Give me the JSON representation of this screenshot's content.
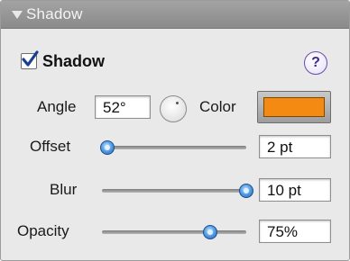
{
  "panel": {
    "title": "Shadow",
    "enable_checkbox": {
      "label": "Shadow",
      "checked": true
    },
    "help_symbol": "?"
  },
  "angle": {
    "label": "Angle",
    "value": "52°"
  },
  "color": {
    "label": "Color",
    "swatch_hex": "#f58a12"
  },
  "offset": {
    "label": "Offset",
    "value": "2 pt",
    "slider_fraction": 0.04
  },
  "blur": {
    "label": "Blur",
    "value": "10 pt",
    "slider_fraction": 1.0
  },
  "opacity": {
    "label": "Opacity",
    "value": "75%",
    "slider_fraction": 0.75
  },
  "colors": {
    "knob": "#3d86d6",
    "swatch": "#f58a12",
    "help_icon": "#6a4fa8"
  }
}
